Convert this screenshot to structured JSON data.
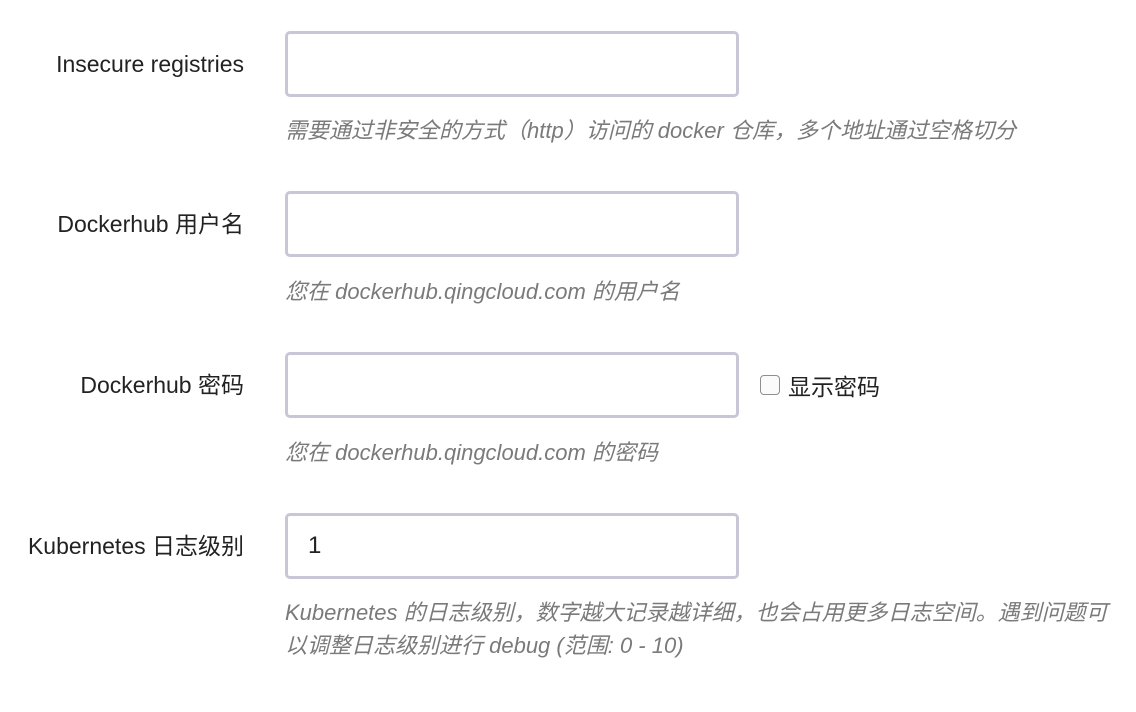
{
  "fields": [
    {
      "label": "Insecure registries",
      "value": "",
      "help": "需要通过非安全的方式（http）访问的 docker 仓库，多个地址通过空格切分"
    },
    {
      "label": "Dockerhub 用户名",
      "value": "",
      "help": "您在 dockerhub.qingcloud.com 的用户名"
    },
    {
      "label": "Dockerhub 密码",
      "value": "",
      "help": "您在 dockerhub.qingcloud.com 的密码",
      "show_password_label": "显示密码",
      "show_password_checked": false
    },
    {
      "label": "Kubernetes 日志级别",
      "value": "1",
      "help": "Kubernetes 的日志级别，数字越大记录越详细，也会占用更多日志空间。遇到问题可以调整日志级别进行 debug (范围: 0 - 10)"
    }
  ]
}
